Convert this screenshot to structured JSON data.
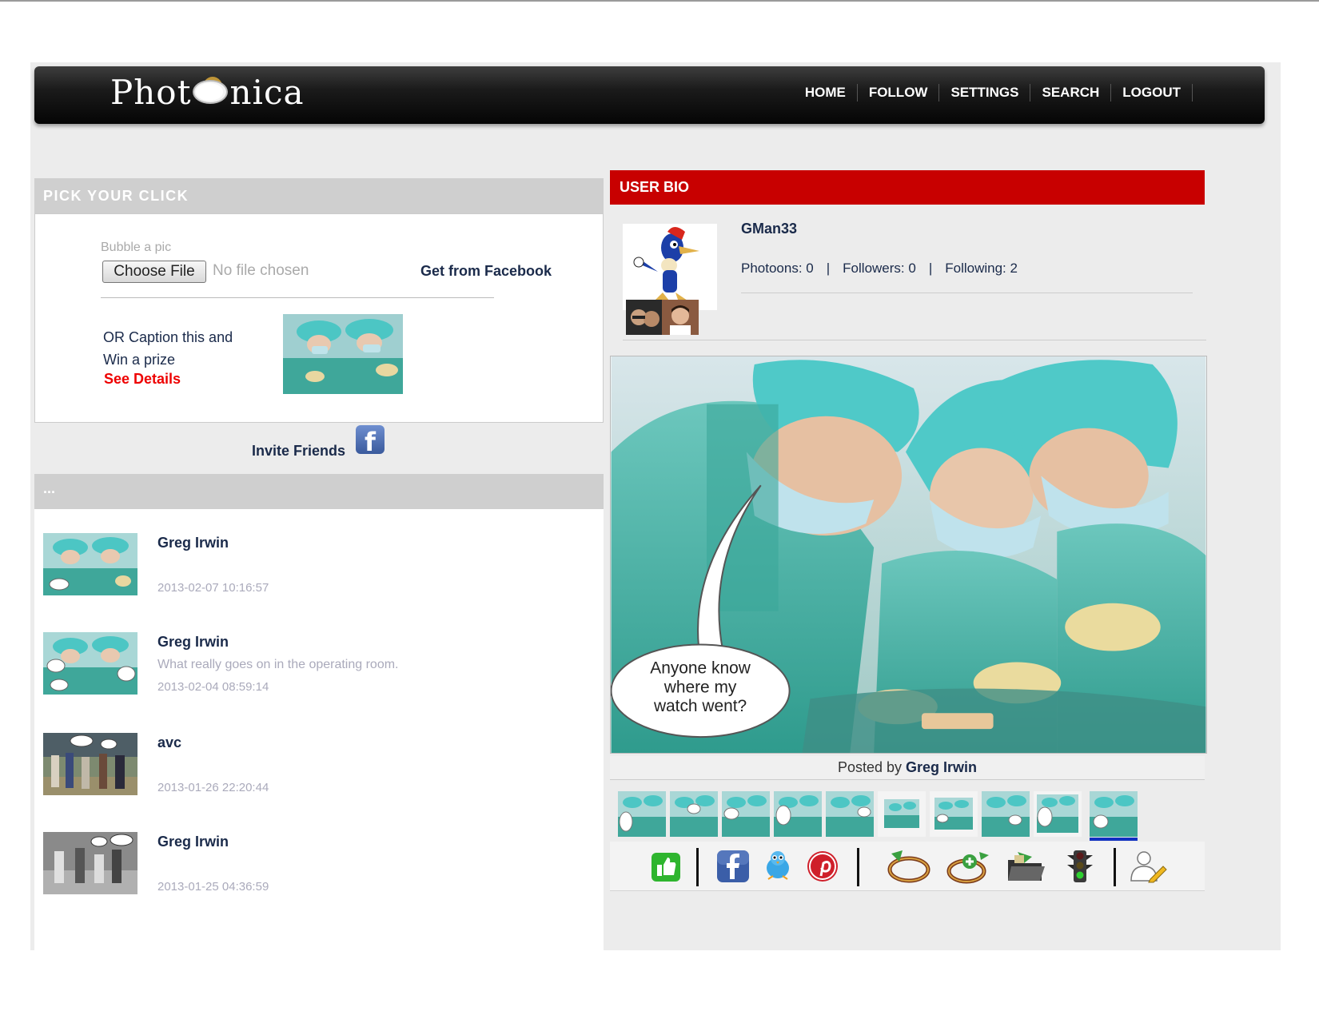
{
  "app": {
    "logo_text_left": "Phot",
    "logo_text_right": "nica"
  },
  "nav": [
    {
      "label": "HOME"
    },
    {
      "label": "FOLLOW"
    },
    {
      "label": "SETTINGS"
    },
    {
      "label": "SEARCH"
    },
    {
      "label": "LOGOUT"
    }
  ],
  "pick": {
    "title": "PICK YOUR CLICK",
    "bubble_label": "Bubble a pic",
    "choose_file": "Choose File",
    "no_file": "No file chosen",
    "facebook_link": "Get from Facebook",
    "caption_line1": "OR Caption this and",
    "caption_line2": "Win a prize",
    "see_details": "See Details"
  },
  "invite": {
    "label": "Invite Friends",
    "icon_glyph": "f"
  },
  "feed": {
    "title": "...",
    "items": [
      {
        "name": "Greg Irwin",
        "desc": "",
        "time": "2013-02-07 10:16:57",
        "thumb": "surgery"
      },
      {
        "name": "Greg Irwin",
        "desc": "What really goes on in the operating room.",
        "time": "2013-02-04 08:59:14",
        "thumb": "surgery"
      },
      {
        "name": "avc",
        "desc": "",
        "time": "2013-01-26 22:20:44",
        "thumb": "crowd"
      },
      {
        "name": "Greg Irwin",
        "desc": "",
        "time": "2013-01-25 04:36:59",
        "thumb": "baseball"
      }
    ]
  },
  "bio": {
    "title": "USER BIO",
    "username": "GMan33",
    "photoons": "Photoons: 0",
    "followers": "Followers: 0",
    "following": "Following: 2",
    "separator": "|"
  },
  "photo": {
    "speech_line1": "Anyone know",
    "speech_line2": "where my",
    "speech_line3": "watch went?",
    "posted_prefix": "Posted by",
    "posted_by": "Greg Irwin"
  },
  "toolbar_icons": [
    "like-icon",
    "facebook-icon",
    "twitter-icon",
    "pinterest-icon",
    "rotate-icon",
    "add-caption-icon",
    "save-folder-icon",
    "traffic-light-icon",
    "edit-user-icon"
  ],
  "colors": {
    "accent_red": "#c80000",
    "link_navy": "#1a2a4a",
    "details_red": "#ee0000"
  }
}
